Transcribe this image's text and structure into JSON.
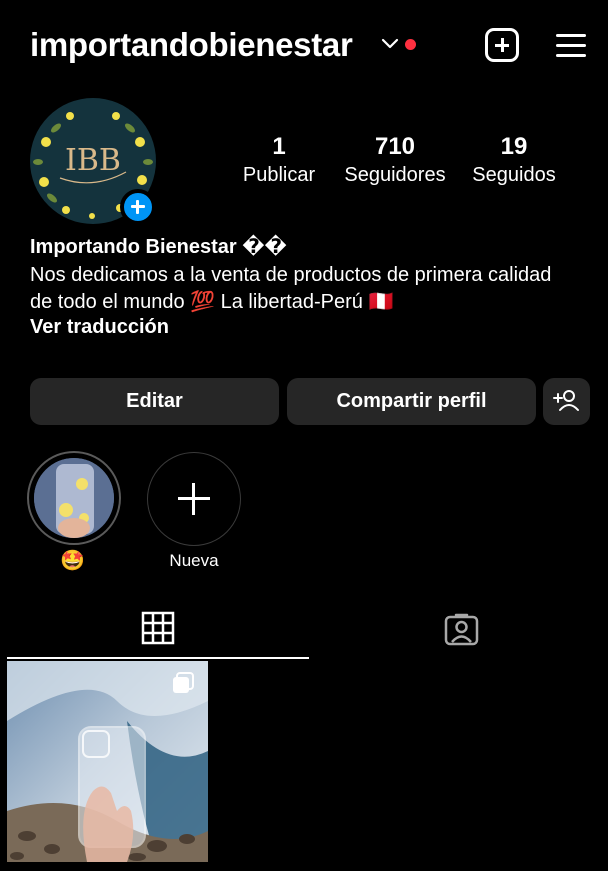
{
  "header": {
    "username": "importandobienestar",
    "chevron_icon": "chevron-down-icon",
    "notification_color": "#ff3040",
    "add_icon": "plus-square-icon",
    "menu_icon": "hamburger-menu-icon"
  },
  "profile": {
    "avatar_monogram": "IBB",
    "add_story_color": "#0095f6",
    "stats": [
      {
        "value": "1",
        "label": "Publicar"
      },
      {
        "value": "710",
        "label": "Seguidores"
      },
      {
        "value": "19",
        "label": "Seguidos"
      }
    ],
    "display_name": "Importando Bienestar ��",
    "bio_line1": "Nos dedicamos a la venta de productos de primera calidad",
    "bio_line2": "de todo el mundo 💯 La libertad-Perú 🇵🇪",
    "translate_label": "Ver traducción"
  },
  "actions": {
    "edit_label": "Editar",
    "share_label": "Compartir perfil",
    "add_person_icon": "add-person-icon"
  },
  "highlights": [
    {
      "label": "🤩"
    },
    {
      "label": "Nueva"
    }
  ],
  "tabs": {
    "grid_icon": "grid-icon",
    "tagged_icon": "tagged-icon"
  },
  "posts": [
    {
      "type": "carousel",
      "icon": "multiple-images-icon"
    }
  ]
}
